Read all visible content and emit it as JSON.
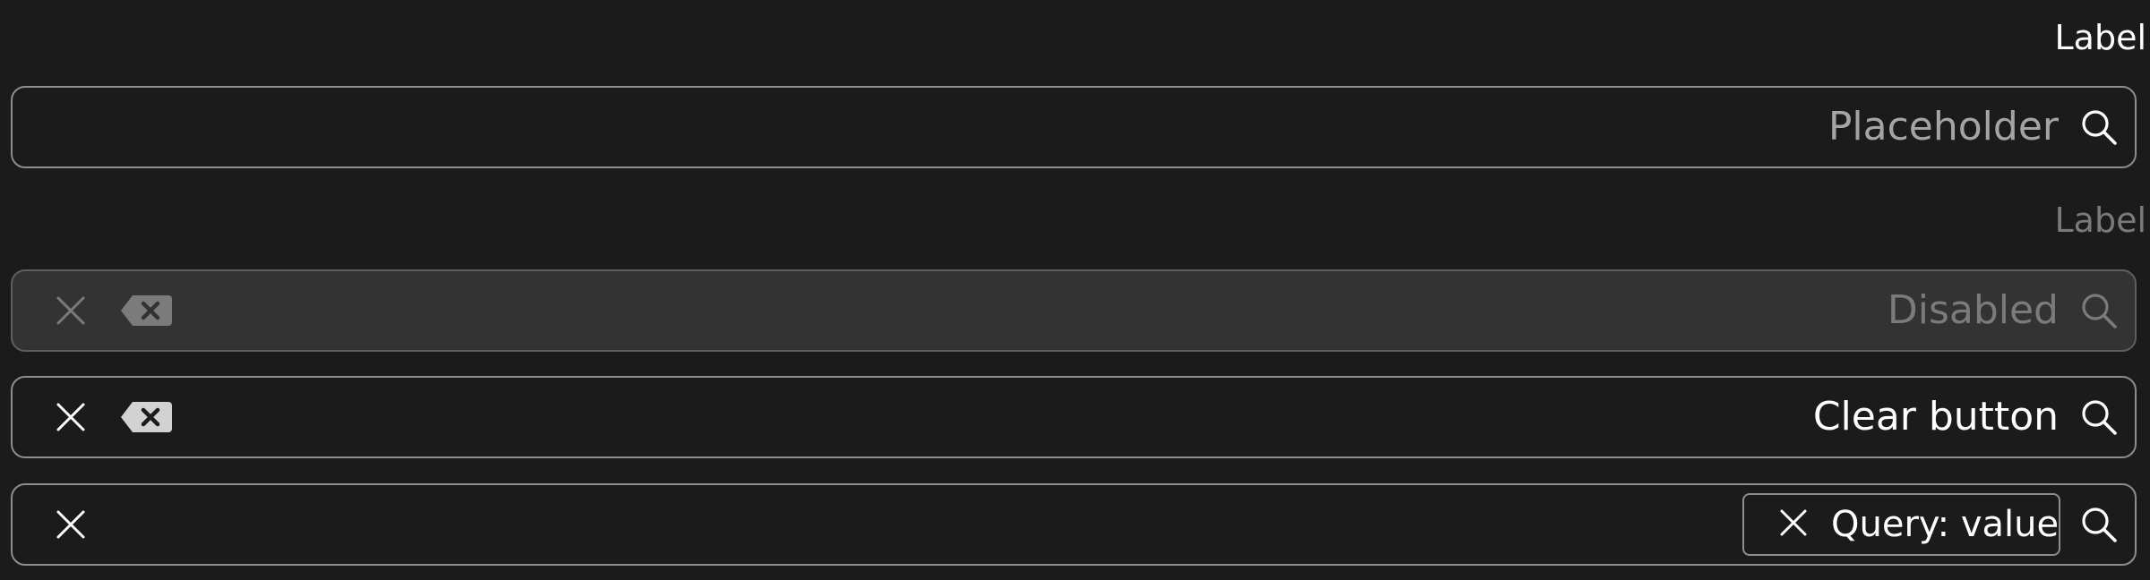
{
  "labels": {
    "active": "Label",
    "disabled": "Label"
  },
  "fields": [
    {
      "state": "default",
      "placeholder": "Placeholder",
      "icons": [
        "search-icon"
      ]
    },
    {
      "state": "disabled",
      "text": "Disabled",
      "icons": [
        "clear-icon",
        "backspace-icon",
        "search-icon"
      ]
    },
    {
      "state": "filled",
      "value": "Clear button",
      "icons": [
        "clear-icon",
        "backspace-icon",
        "search-icon"
      ]
    },
    {
      "state": "with-query-chip",
      "chip": {
        "label": "Query: value",
        "icon": "clear-icon"
      },
      "icons": [
        "clear-icon",
        "search-icon"
      ]
    }
  ],
  "colors": {
    "background": "#1b1b1b",
    "border": "#8d8d8d",
    "text_primary": "#ffffff",
    "text_placeholder": "#a4a4a4",
    "text_disabled": "#7b7b7b",
    "disabled_fill": "#333333"
  }
}
